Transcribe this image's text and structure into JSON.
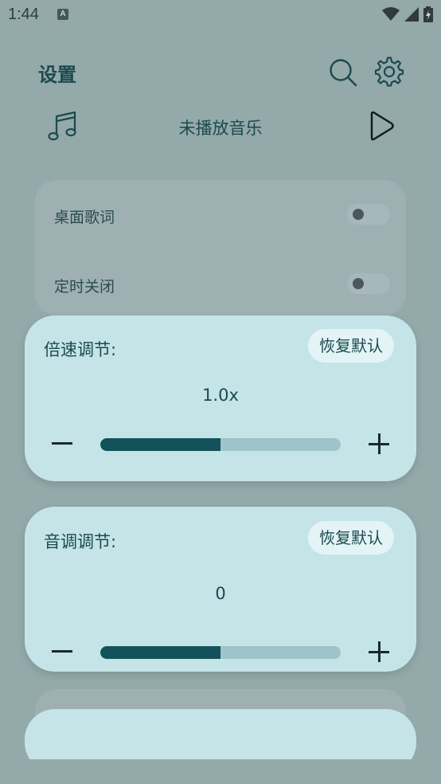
{
  "status_bar": {
    "time": "1:44",
    "notification_icon": "A"
  },
  "header": {
    "title": "设置",
    "search_icon": "search-icon",
    "settings_icon": "gear-icon"
  },
  "player": {
    "now_playing": "未播放音乐",
    "note_icon": "music-note-icon",
    "play_icon": "play-icon"
  },
  "toggles": [
    {
      "label": "桌面歌词",
      "on": false
    },
    {
      "label": "定时关闭",
      "on": false
    }
  ],
  "speed_card": {
    "label": "倍速调节:",
    "reset_label": "恢复默认",
    "value_text": "1.0x",
    "slider_fraction": 0.5
  },
  "pitch_card": {
    "label": "音调调节:",
    "reset_label": "恢复默认",
    "value_text": "0",
    "slider_fraction": 0.5
  },
  "colors": {
    "accent": "#13525a",
    "card": "#c4e4e8",
    "background": "#93a9aa"
  }
}
